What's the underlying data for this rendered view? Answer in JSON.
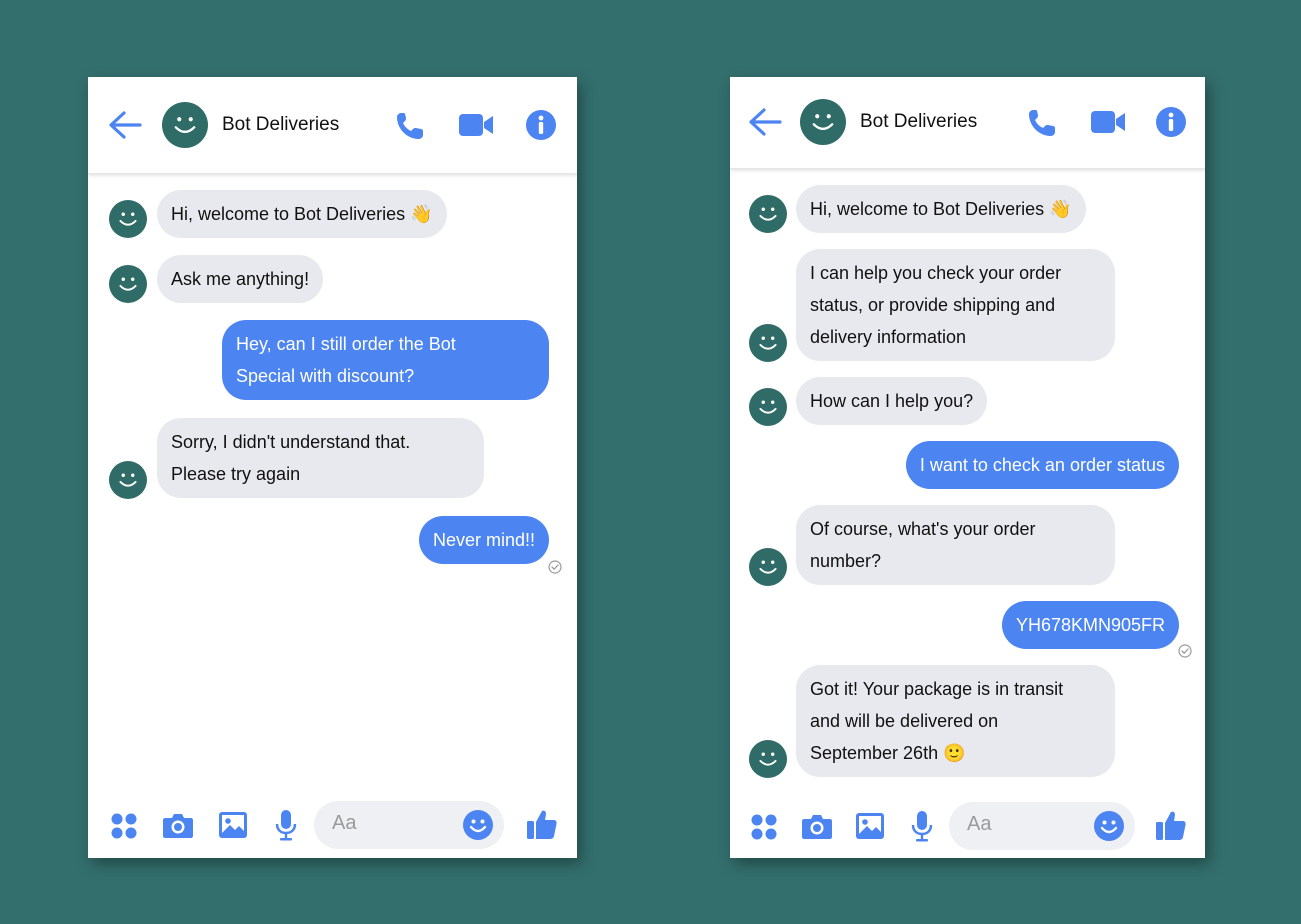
{
  "colors": {
    "accent": "#4c84f1",
    "bot_avatar": "#2f6b67",
    "bot_bubble": "#e7e9ee",
    "background": "#336f6d"
  },
  "left": {
    "header": {
      "title": "Bot Deliveries"
    },
    "messages": [
      {
        "from": "bot",
        "text": "Hi, welcome to Bot Deliveries 👋"
      },
      {
        "from": "bot",
        "text": "Ask me anything!"
      },
      {
        "from": "user",
        "text": "Hey, can I still order the Bot\nSpecial with discount?"
      },
      {
        "from": "bot",
        "text": "Sorry, I didn't understand that.\nPlease try again"
      },
      {
        "from": "user",
        "text": "Never mind!!"
      }
    ],
    "composer": {
      "placeholder": "Aa"
    }
  },
  "right": {
    "header": {
      "title": "Bot Deliveries"
    },
    "messages": [
      {
        "from": "bot",
        "text": "Hi, welcome to Bot Deliveries 👋"
      },
      {
        "from": "bot",
        "text": "I can help you check your order\nstatus, or provide shipping and\ndelivery information"
      },
      {
        "from": "bot",
        "text": "How can I help you?"
      },
      {
        "from": "user",
        "text": "I want to check an order status"
      },
      {
        "from": "bot",
        "text": "Of course, what's your order\nnumber?"
      },
      {
        "from": "user",
        "text": "YH678KMN905FR"
      },
      {
        "from": "bot",
        "text": "Got it! Your package is in transit\nand will be delivered on\nSeptember 26th 🙂"
      }
    ],
    "composer": {
      "placeholder": "Aa"
    }
  },
  "icons": {
    "back": "arrow-left-icon",
    "call": "phone-icon",
    "video": "video-camera-icon",
    "info": "info-icon",
    "more": "four-dots-icon",
    "camera": "camera-icon",
    "photo": "image-icon",
    "mic": "microphone-icon",
    "emoji": "smiley-icon",
    "like": "thumbs-up-icon",
    "avatar": "smiley-face-avatar",
    "seen": "check-circle-icon"
  }
}
